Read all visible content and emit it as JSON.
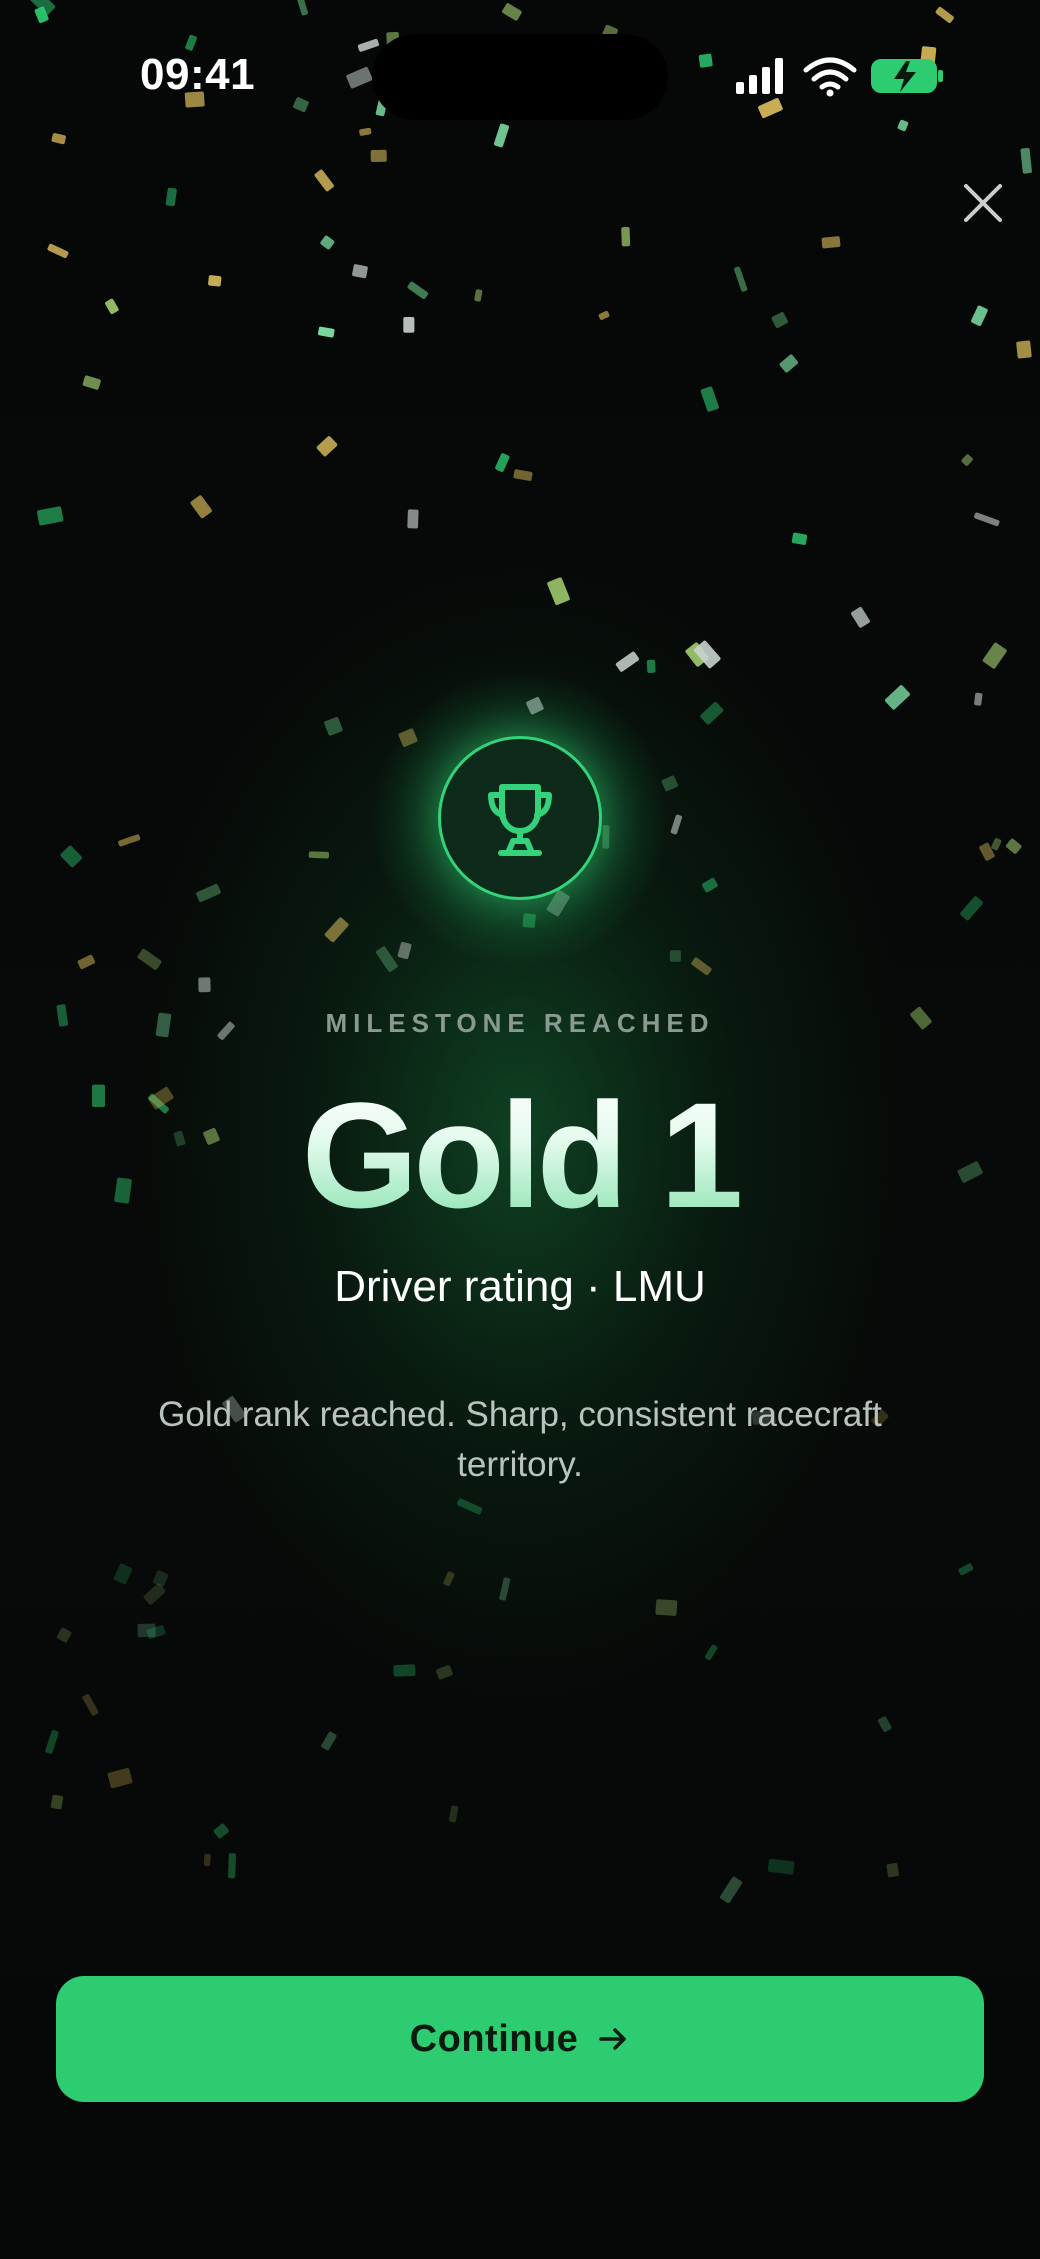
{
  "status_bar": {
    "time": "09:41",
    "icons": [
      "cellular-signal-icon",
      "wifi-icon",
      "battery-charging-icon"
    ]
  },
  "header": {
    "close_icon": "close-icon"
  },
  "milestone": {
    "icon": "trophy-icon",
    "eyebrow": "MILESTONE REACHED",
    "rank": "Gold 1",
    "subtitle": "Driver rating · LMU",
    "description": "Gold rank reached. Sharp, consistent racecraft territory."
  },
  "actions": {
    "continue_label": "Continue",
    "continue_icon": "arrow-right-icon"
  },
  "colors": {
    "accent": "#2ecc71",
    "background": "#070908",
    "confetti": [
      "#2ecc71",
      "#7fe0a7",
      "#d4b85a",
      "#c9d3cd",
      "#4a8c5c",
      "#9cc66b"
    ]
  }
}
